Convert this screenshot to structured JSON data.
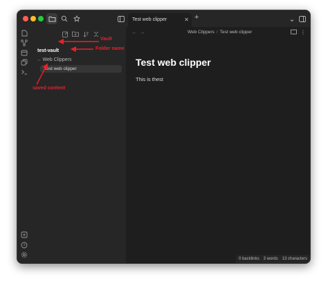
{
  "tabs": [
    {
      "title": "Test web clipper"
    }
  ],
  "sidebar": {
    "vault": "test-vault",
    "folder": "Web Clippers",
    "file": "Test web clipper"
  },
  "breadcrumb": {
    "folder": "Web Clippers",
    "separator": "/",
    "file": "Test web clipper"
  },
  "document": {
    "title": "Test web clipper",
    "body": "This is thest"
  },
  "status": {
    "backlinks": "0 backlinks",
    "words": "3 words",
    "characters": "13 characters"
  },
  "annotations": {
    "vault": "Vault",
    "folder": "Folder name",
    "content": "saved content"
  },
  "colors": {
    "annotation": "#e8202a",
    "background": "#1e1e1e",
    "sidebar": "#262626"
  },
  "icons": {
    "titlebar": [
      "folder-icon",
      "search-icon",
      "star-icon",
      "sidebar-toggle-icon"
    ],
    "ribbon": [
      "files-icon",
      "graph-icon",
      "calendar-icon",
      "copy-icon",
      "terminal-icon",
      "vault-switch-icon",
      "help-icon",
      "settings-icon"
    ],
    "sidebar_toolbar": [
      "new-note-icon",
      "new-folder-icon",
      "sort-icon",
      "collapse-icon"
    ]
  }
}
